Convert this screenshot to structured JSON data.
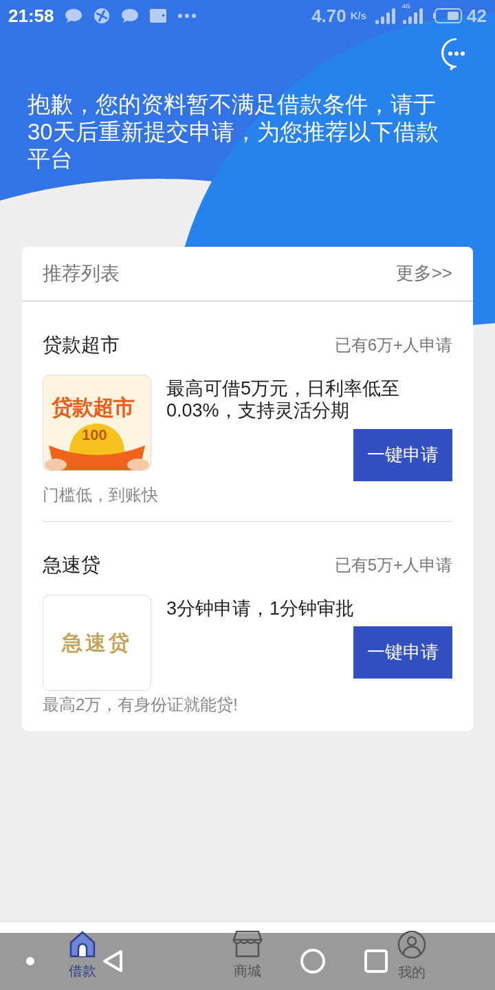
{
  "status_bar": {
    "time": "21:58",
    "speed": "4.70",
    "speed_unit": "K/s",
    "network": "4G",
    "battery": "42"
  },
  "header": {
    "message": "抱歉，您的资料暂不满足借款条件，请于30天后重新提交申请，为您推荐以下借款平台"
  },
  "list": {
    "title": "推荐列表",
    "more": "更多>>",
    "items": [
      {
        "kind": "market",
        "name": "贷款超市",
        "applicants": "已有6万+人申请",
        "logo_text": "贷款超市",
        "coin_text": "100",
        "description": "最高可借5万元，日利率低至0.03%，支持灵活分期",
        "button": "一键申请",
        "note": "门槛低，到账快"
      },
      {
        "kind": "fast",
        "name": "急速贷",
        "applicants": "已有5万+人申请",
        "logo_text": "急速贷",
        "description": "3分钟申请，1分钟审批",
        "button": "一键申请",
        "note": "最高2万，有身份证就能贷!"
      }
    ]
  },
  "tabs": [
    {
      "label": "借款",
      "selected": true
    },
    {
      "label": "商城",
      "selected": false
    },
    {
      "label": "我的",
      "selected": false
    }
  ]
}
